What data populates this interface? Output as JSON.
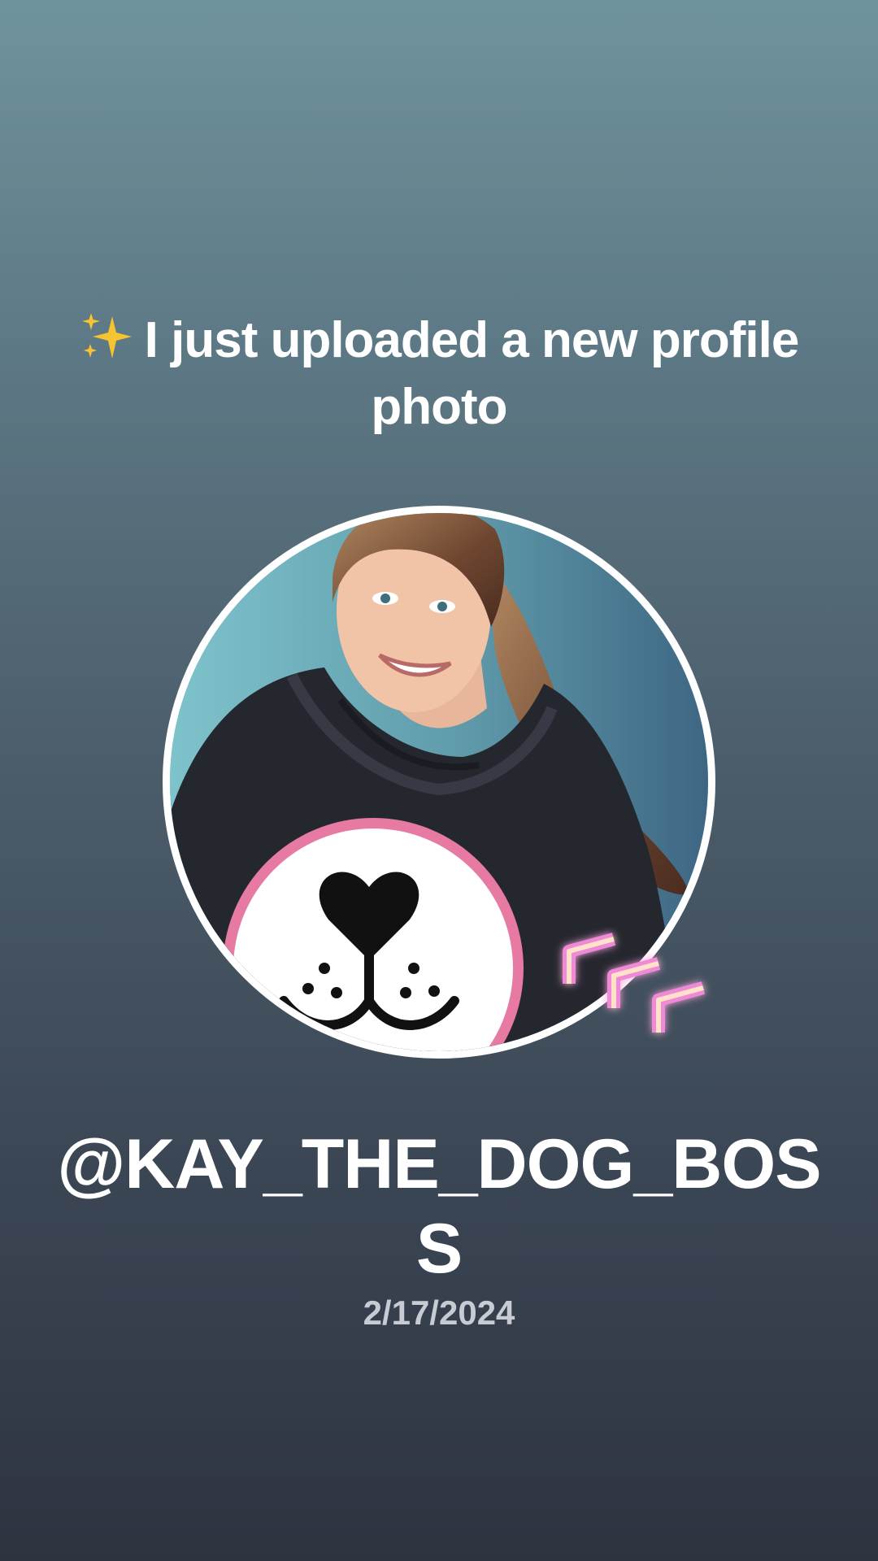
{
  "post": {
    "announcement": "I just uploaded a new profile photo",
    "leading_icon": "sparkles-icon",
    "username": "@KAY_THE_DOG_BOSS",
    "date": "2/17/2024"
  },
  "avatar": {
    "icon": "profile-photo",
    "border_color": "#ffffff",
    "badge_icon": "chevron-stack-boost-icon",
    "badge_color": "#e879c9"
  },
  "colors": {
    "background_top": "#6f939c",
    "background_bottom": "#2e3340",
    "text_primary": "#ffffff",
    "text_secondary": "#c7ccd3",
    "sparkle": "#f6c431"
  }
}
